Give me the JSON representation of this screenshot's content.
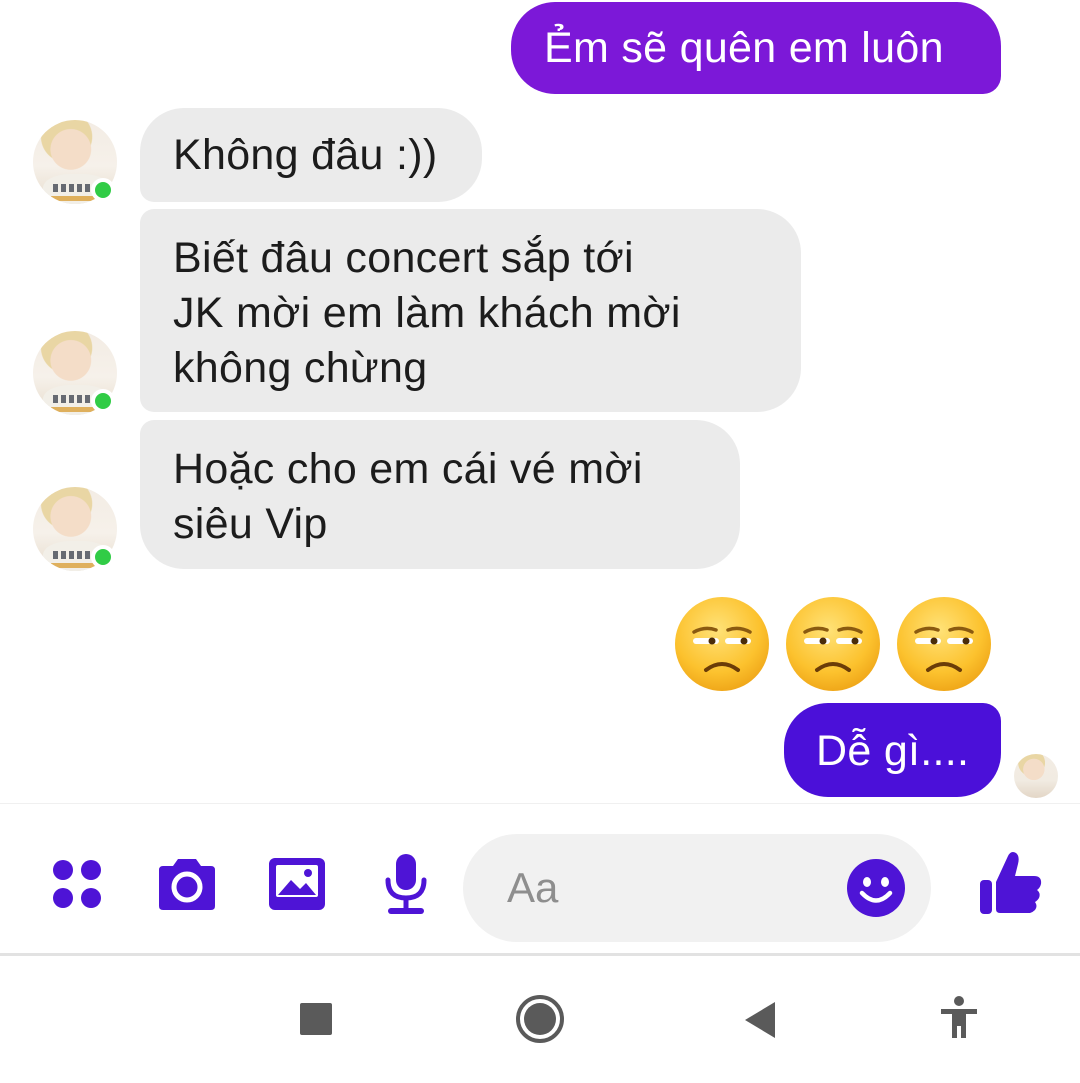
{
  "colors": {
    "accent": "#4e14d6",
    "outgoing_top": "#7a18d8",
    "outgoing_bottom": "#4a0fd9",
    "incoming_bg": "#ebebeb",
    "online": "#31cc46"
  },
  "messages": [
    {
      "direction": "outgoing",
      "lines": [
        "Ẻm sẽ quên em luôn"
      ]
    },
    {
      "direction": "incoming",
      "lines": [
        "Không đâu :))"
      ]
    },
    {
      "direction": "incoming",
      "lines": [
        "Biết đâu concert sắp tới",
        "JK mời em làm khách mời",
        "không chừng"
      ]
    },
    {
      "direction": "incoming",
      "lines": [
        "Hoặc cho em cái vé mời",
        "siêu Vip"
      ]
    },
    {
      "direction": "outgoing",
      "emoji": [
        "unamused-face",
        "unamused-face",
        "unamused-face"
      ]
    },
    {
      "direction": "outgoing",
      "lines": [
        "Dễ gì...."
      ]
    }
  ],
  "composer": {
    "placeholder": "Aa",
    "icons": [
      "apps-grid-icon",
      "camera-icon",
      "gallery-icon",
      "microphone-icon",
      "emoji-icon",
      "thumbs-up-icon"
    ]
  },
  "navbar": {
    "icons": [
      "recents-square-icon",
      "home-circle-icon",
      "back-triangle-icon",
      "accessibility-icon"
    ]
  }
}
